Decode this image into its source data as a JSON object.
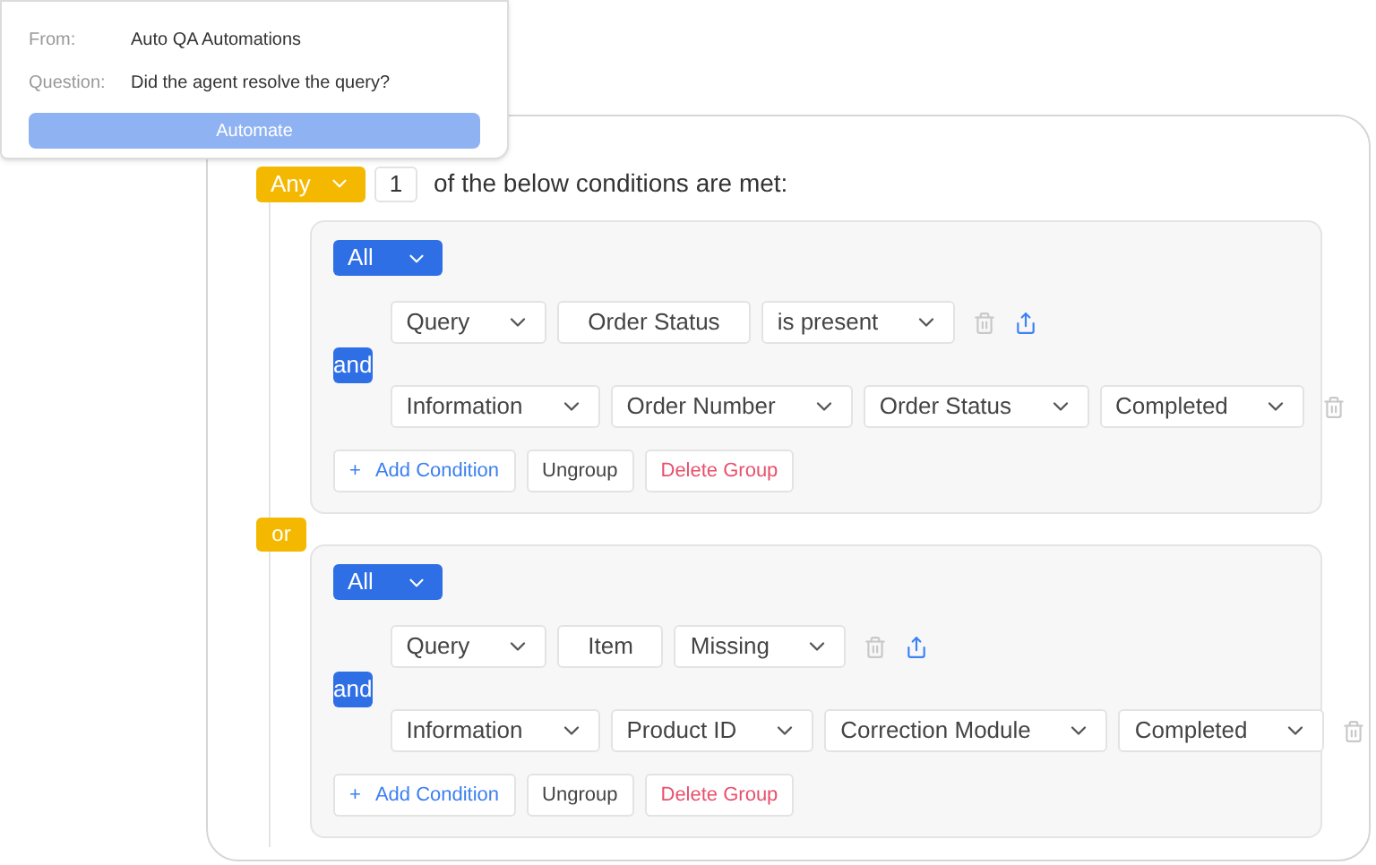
{
  "popup": {
    "from_label": "From:",
    "from_value": "Auto QA Automations",
    "question_label": "Question:",
    "question_value": "Did the agent resolve the query?",
    "button": "Automate"
  },
  "root": {
    "match": "Any",
    "count": "1",
    "text": "of the below conditions are met:"
  },
  "groups": [
    {
      "match": "All",
      "joiner": "and",
      "rows": [
        {
          "kind": "movable",
          "fields": [
            {
              "kind": "select",
              "value": "Query"
            },
            {
              "kind": "text",
              "value": "Order Status"
            },
            {
              "kind": "select",
              "value": "is present"
            }
          ]
        },
        {
          "kind": "basic",
          "fields": [
            {
              "kind": "select",
              "value": "Information"
            },
            {
              "kind": "select",
              "value": "Order Number"
            },
            {
              "kind": "select",
              "value": "Order Status"
            },
            {
              "kind": "select",
              "value": "Completed"
            }
          ]
        }
      ],
      "buttons": {
        "add": "Add Condition",
        "add_icon": "+",
        "ungroup": "Ungroup",
        "delete": "Delete Group"
      }
    },
    {
      "match": "All",
      "joiner": "and",
      "rows": [
        {
          "kind": "movable",
          "fields": [
            {
              "kind": "select",
              "value": "Query"
            },
            {
              "kind": "text",
              "value": "Item"
            },
            {
              "kind": "select",
              "value": "Missing"
            }
          ]
        },
        {
          "kind": "basic",
          "fields": [
            {
              "kind": "select",
              "value": "Information"
            },
            {
              "kind": "select",
              "value": "Product ID"
            },
            {
              "kind": "select",
              "value": "Correction Module"
            },
            {
              "kind": "select",
              "value": "Completed"
            }
          ]
        }
      ],
      "buttons": {
        "add": "Add Condition",
        "add_icon": "+",
        "ungroup": "Ungroup",
        "delete": "Delete Group"
      }
    }
  ],
  "group_joiner": "or"
}
